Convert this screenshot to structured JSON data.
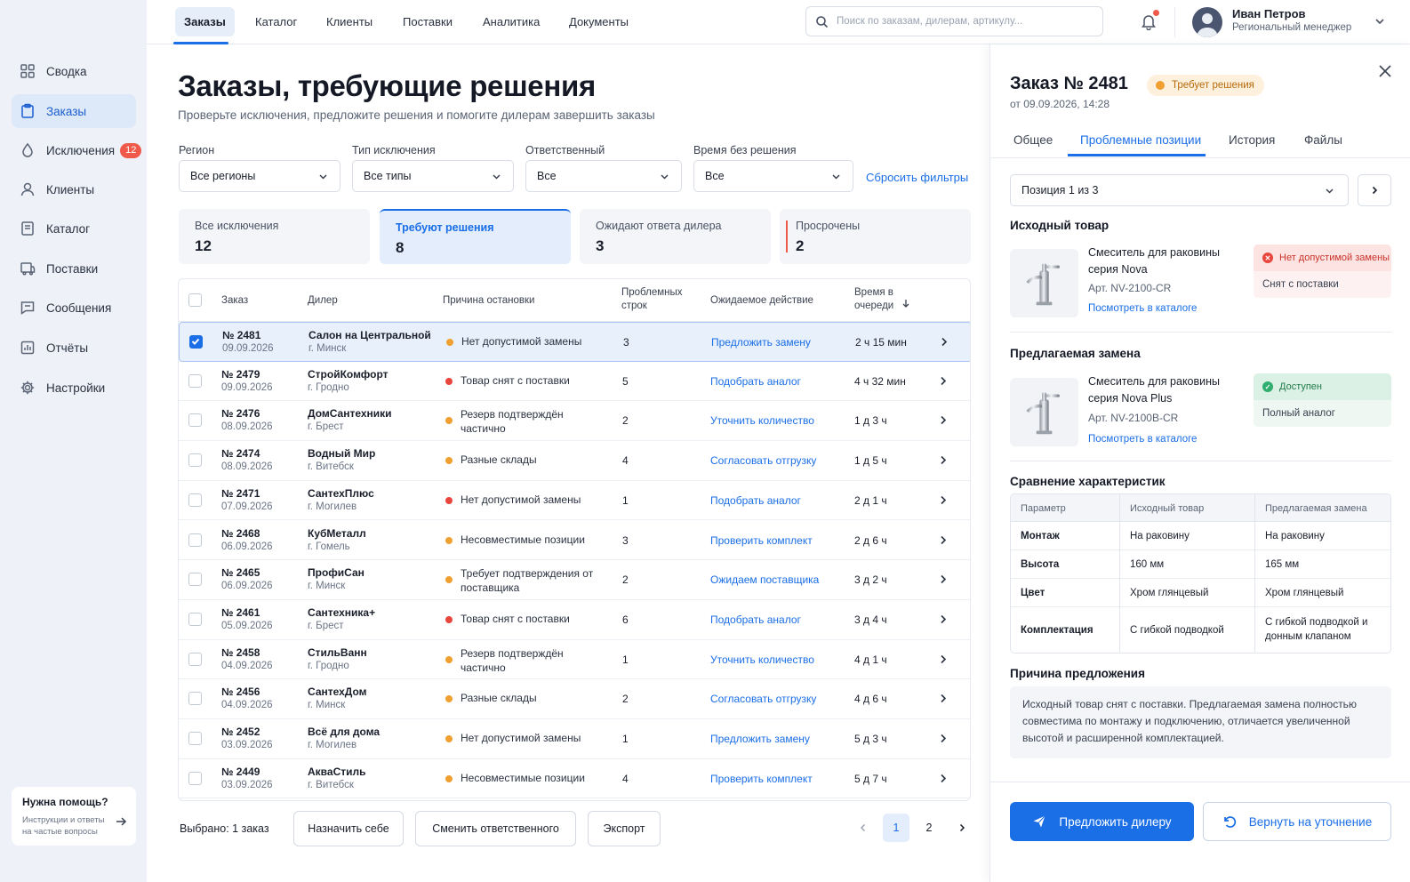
{
  "sidebar": {
    "items": [
      {
        "label": "Сводка",
        "icon": "grid-icon"
      },
      {
        "label": "Заказы",
        "icon": "clipboard-icon",
        "active": true
      },
      {
        "label": "Исключения",
        "icon": "alert-drop-icon",
        "badge": "12"
      },
      {
        "label": "Клиенты",
        "icon": "user-icon"
      },
      {
        "label": "Каталог",
        "icon": "book-icon"
      },
      {
        "label": "Поставки",
        "icon": "truck-icon"
      },
      {
        "label": "Сообщения",
        "icon": "message-icon"
      },
      {
        "label": "Отчёты",
        "icon": "chart-icon"
      },
      {
        "label": "Настройки",
        "icon": "gear-icon"
      }
    ],
    "help": {
      "title": "Нужна помощь?",
      "text": "Инструкции и ответы на частые вопросы"
    }
  },
  "topbar": {
    "tabs": [
      "Заказы",
      "Каталог",
      "Клиенты",
      "Поставки",
      "Аналитика",
      "Документы"
    ],
    "search_placeholder": "Поиск по заказам, дилерам, артикулу...",
    "user": {
      "name": "Иван Петров",
      "role": "Региональный менеджер"
    }
  },
  "main": {
    "title": "Заказы, требующие решения",
    "subtitle": "Проверьте исключения, предложите решения и помогите дилерам завершить заказы",
    "filters": [
      {
        "label": "Регион",
        "value": "Все регионы"
      },
      {
        "label": "Тип исключения",
        "value": "Все типы"
      },
      {
        "label": "Ответственный",
        "value": "Все"
      },
      {
        "label": "Время без решения",
        "value": "Все"
      }
    ],
    "reset_label": "Сбросить фильтры",
    "stats": [
      {
        "label": "Все исключения",
        "value": "12"
      },
      {
        "label": "Требуют решения",
        "value": "8"
      },
      {
        "label": "Ожидают ответа дилера",
        "value": "3"
      },
      {
        "label": "Просрочены",
        "value": "2"
      }
    ],
    "table": {
      "headers": {
        "order": "Заказ",
        "dealer": "Дилер",
        "reason": "Причина остановки",
        "rows": "Проблемных строк",
        "action": "Ожидаемое действие",
        "time": "Время в очереди"
      },
      "rows": [
        {
          "num": "№ 2481",
          "date": "09.09.2026",
          "dealer": "Салон на Центральной",
          "city": "г. Минск",
          "status": "orange",
          "reason": "Нет допустимой замены",
          "count": "3",
          "action": "Предложить замену",
          "time": "2 ч 15 мин",
          "selected": true
        },
        {
          "num": "№ 2479",
          "date": "09.09.2026",
          "dealer": "СтройКомфорт",
          "city": "г. Гродно",
          "status": "red",
          "reason": "Товар снят с поставки",
          "count": "5",
          "action": "Подобрать аналог",
          "time": "4 ч 32 мин"
        },
        {
          "num": "№ 2476",
          "date": "08.09.2026",
          "dealer": "ДомСантехники",
          "city": "г. Брест",
          "status": "orange",
          "reason": "Резерв подтверждён частично",
          "count": "2",
          "action": "Уточнить количество",
          "time": "1 д 3 ч"
        },
        {
          "num": "№ 2474",
          "date": "08.09.2026",
          "dealer": "Водный Мир",
          "city": "г. Витебск",
          "status": "orange",
          "reason": "Разные склады",
          "count": "4",
          "action": "Согласовать отгрузку",
          "time": "1 д 5 ч"
        },
        {
          "num": "№ 2471",
          "date": "07.09.2026",
          "dealer": "СантехПлюс",
          "city": "г. Могилев",
          "status": "red",
          "reason": "Нет допустимой замены",
          "count": "1",
          "action": "Подобрать аналог",
          "time": "2 д 1 ч"
        },
        {
          "num": "№ 2468",
          "date": "06.09.2026",
          "dealer": "КубМеталл",
          "city": "г. Гомель",
          "status": "orange",
          "reason": "Несовместимые позиции",
          "count": "3",
          "action": "Проверить комплект",
          "time": "2 д 6 ч"
        },
        {
          "num": "№ 2465",
          "date": "06.09.2026",
          "dealer": "ПрофиСан",
          "city": "г. Минск",
          "status": "orange",
          "reason": "Требует подтверждения от поставщика",
          "count": "2",
          "action": "Ожидаем поставщика",
          "time": "3 д 2 ч"
        },
        {
          "num": "№ 2461",
          "date": "05.09.2026",
          "dealer": "Сантехника+",
          "city": "г. Брест",
          "status": "red",
          "reason": "Товар снят с поставки",
          "count": "6",
          "action": "Подобрать аналог",
          "time": "3 д 4 ч"
        },
        {
          "num": "№ 2458",
          "date": "04.09.2026",
          "dealer": "СтильВанн",
          "city": "г. Гродно",
          "status": "orange",
          "reason": "Резерв подтверждён частично",
          "count": "1",
          "action": "Уточнить количество",
          "time": "4 д 1 ч"
        },
        {
          "num": "№ 2456",
          "date": "04.09.2026",
          "dealer": "СантехДом",
          "city": "г. Минск",
          "status": "orange",
          "reason": "Разные склады",
          "count": "2",
          "action": "Согласовать отгрузку",
          "time": "4 д 6 ч"
        },
        {
          "num": "№ 2452",
          "date": "03.09.2026",
          "dealer": "Всё для дома",
          "city": "г. Могилев",
          "status": "orange",
          "reason": "Нет допустимой замены",
          "count": "1",
          "action": "Предложить замену",
          "time": "5 д 3 ч"
        },
        {
          "num": "№ 2449",
          "date": "03.09.2026",
          "dealer": "АкваСтиль",
          "city": "г. Витебск",
          "status": "orange",
          "reason": "Несовместимые позиции",
          "count": "4",
          "action": "Проверить комплект",
          "time": "5 д 7 ч"
        }
      ]
    },
    "footer": {
      "selected": "Выбрано: 1 заказ",
      "buttons": [
        "Назначить себе",
        "Сменить ответственного",
        "Экспорт"
      ],
      "pages": [
        "1",
        "2"
      ]
    }
  },
  "panel": {
    "title": "Заказ № 2481",
    "badge": "Требует решения",
    "date": "от 09.09.2026, 14:28",
    "tabs": [
      "Общее",
      "Проблемные позиции",
      "История",
      "Файлы"
    ],
    "position": "Позиция 1 из 3",
    "source": {
      "section": "Исходный товар",
      "name": "Смеситель для раковины серия Nova",
      "article": "Арт. NV-2100-CR",
      "link": "Посмотреть в каталоге",
      "status": "Нет допустимой замены",
      "note": "Снят с поставки"
    },
    "replacement": {
      "section": "Предлагаемая замена",
      "name": "Смеситель для раковины серия Nova Plus",
      "article": "Арт. NV-2100B-CR",
      "link": "Посмотреть в каталоге",
      "status": "Доступен",
      "note": "Полный аналог"
    },
    "compare": {
      "section": "Сравнение характеристик",
      "headers": [
        "Параметр",
        "Исходный товар",
        "Предлагаемая замена"
      ],
      "rows": [
        [
          "Монтаж",
          "На раковину",
          "На раковину"
        ],
        [
          "Высота",
          "160 мм",
          "165 мм"
        ],
        [
          "Цвет",
          "Хром глянцевый",
          "Хром глянцевый"
        ],
        [
          "Комплектация",
          "С гибкой подводкой",
          "С гибкой подводкой и донным клапаном"
        ]
      ]
    },
    "reason": {
      "section": "Причина предложения",
      "text": "Исходный товар снят с поставки. Предлагаемая замена полностью совместима по монтажу и подключению, отличается увеличенной высотой и расширенной комплектацией."
    },
    "actions": {
      "primary": "Предложить дилеру",
      "secondary": "Вернуть на уточнение"
    }
  },
  "colors": {
    "accent": "#1a6ee6",
    "orange": "#f0a030",
    "red": "#e8453c",
    "green": "#2fae6f"
  }
}
